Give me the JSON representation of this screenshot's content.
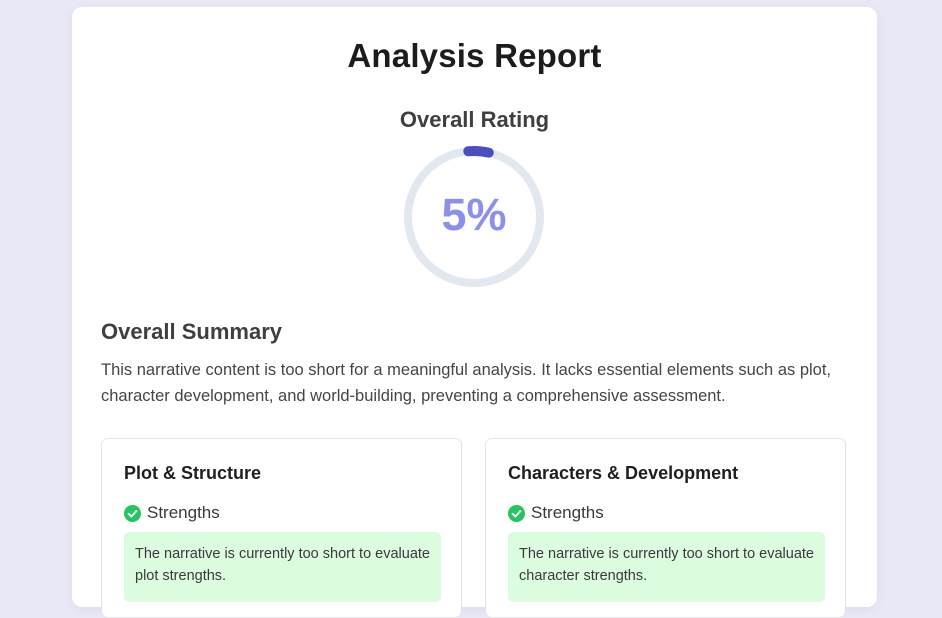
{
  "report": {
    "title": "Analysis Report",
    "rating_title": "Overall Rating",
    "rating_value": "5%",
    "rating_fraction": 0.05,
    "colors": {
      "accent": "#4a4fbf",
      "gauge_track": "#e2e8f0",
      "gauge_text": "#8a90ec",
      "success": "#22c55e",
      "strength_bg": "#dcfce0"
    },
    "summary_heading": "Overall Summary",
    "summary_text": "This narrative content is too short for a meaningful analysis. It lacks essential elements such as plot, character development, and world-building, preventing a comprehensive assessment."
  },
  "sections": [
    {
      "title": "Plot & Structure",
      "strengths_label": "Strengths",
      "strength_text": "The narrative is currently too short to evaluate plot strengths."
    },
    {
      "title": "Characters & Development",
      "strengths_label": "Strengths",
      "strength_text": "The narrative is currently too short to evaluate character strengths."
    }
  ],
  "icons": {
    "check": "check-circle-icon"
  }
}
